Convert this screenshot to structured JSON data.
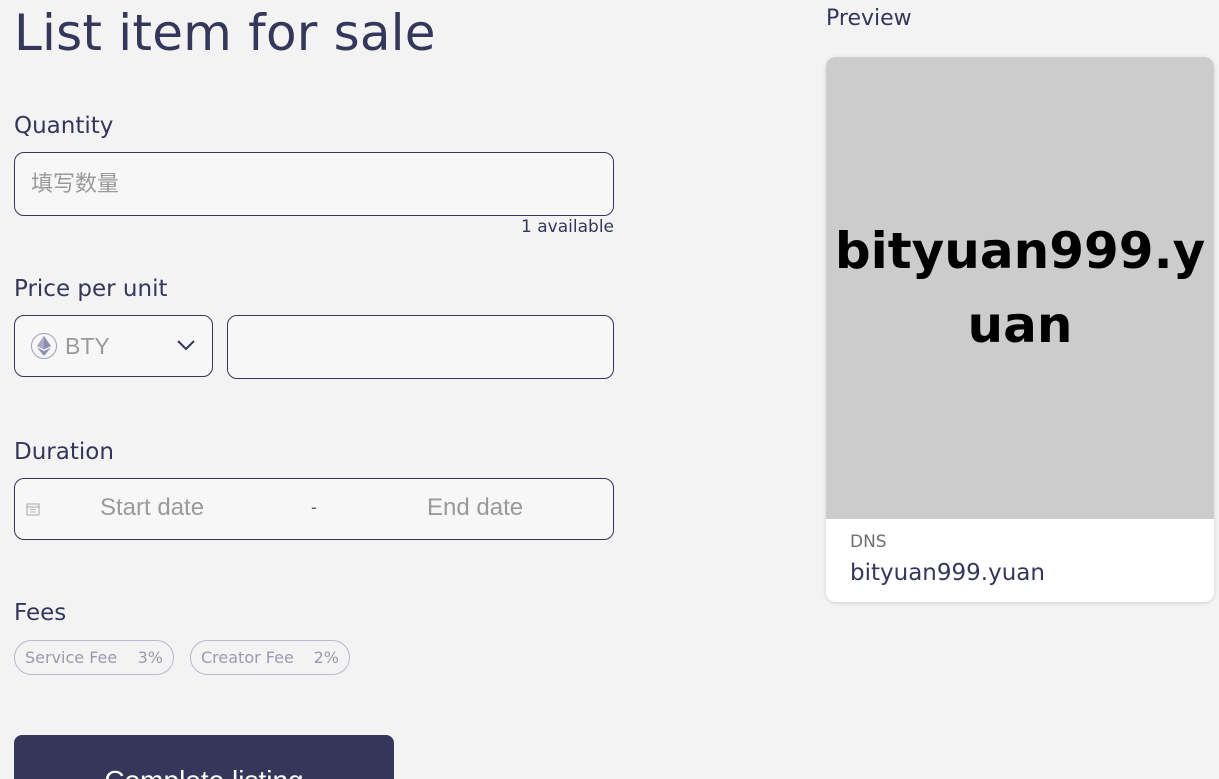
{
  "page": {
    "title": "List item for sale"
  },
  "quantity": {
    "label": "Quantity",
    "placeholder": "填写数量",
    "value": "",
    "available": "1 available"
  },
  "price": {
    "label": "Price per unit",
    "currency": "BTY",
    "currency_icon": "ethereum-icon",
    "value": ""
  },
  "duration": {
    "label": "Duration",
    "start_placeholder": "Start date",
    "separator": "-",
    "end_placeholder": "End date"
  },
  "fees": {
    "label": "Fees",
    "items": [
      {
        "name": "Service Fee",
        "value": "3%"
      },
      {
        "name": "Creator Fee",
        "value": "2%"
      }
    ]
  },
  "actions": {
    "complete_label": "Complete listing"
  },
  "preview": {
    "label": "Preview",
    "image_text": "bityuan999.yuan",
    "type": "DNS",
    "name": "bityuan999.yuan"
  },
  "colors": {
    "primary": "#34375a",
    "background": "#f3f3f3",
    "preview_bg": "#cccccc"
  }
}
